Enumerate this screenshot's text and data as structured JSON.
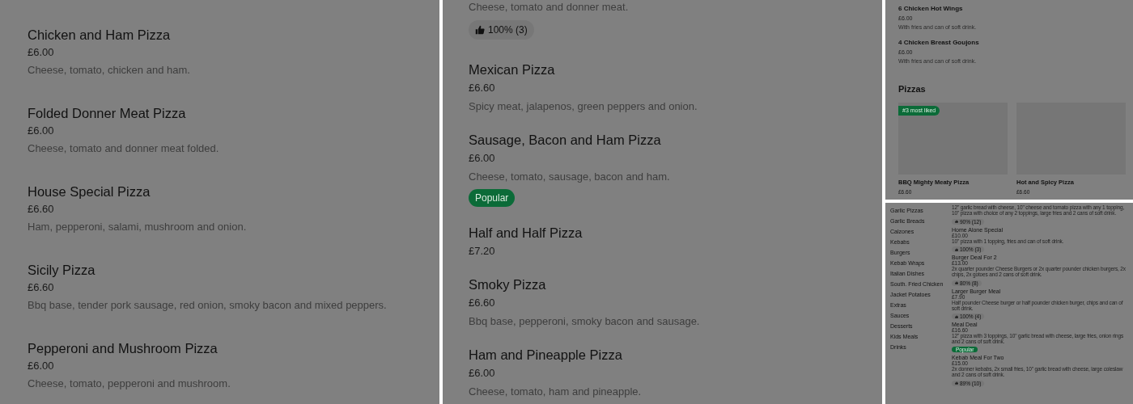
{
  "menu_column_1": {
    "items": [
      {
        "name": "Chicken and Ham Pizza",
        "price": "£6.00",
        "description": "Cheese, tomato, chicken and ham."
      },
      {
        "name": "Folded Donner Meat Pizza",
        "price": "£6.00",
        "description": "Cheese, tomato and donner meat folded."
      },
      {
        "name": "House Special Pizza",
        "price": "£6.60",
        "description": "Ham, pepperoni, salami, mushroom and onion."
      },
      {
        "name": "Sicily Pizza",
        "price": "£6.60",
        "description": "Bbq base, tender pork sausage, red onion, smoky bacon and mixed peppers."
      },
      {
        "name": "Pepperoni and Mushroom Pizza",
        "price": "£6.00",
        "description": "Cheese, tomato, pepperoni and mushroom."
      }
    ]
  },
  "menu_column_2": {
    "items": [
      {
        "description": "Cheese, tomato and donner meat.",
        "rating": "100% (3)"
      },
      {
        "name": "Mexican Pizza",
        "price": "£6.60",
        "description": "Spicy meat, jalapenos, green peppers and onion."
      },
      {
        "name": "Sausage, Bacon and Ham Pizza",
        "price": "£6.00",
        "description": "Cheese, tomato, sausage, bacon and ham.",
        "badge": "Popular"
      },
      {
        "name": "Half and Half Pizza",
        "price": "£7.20"
      },
      {
        "name": "Smoky Pizza",
        "price": "£6.60",
        "description": "Bbq base, pepperoni, smoky bacon and sausage."
      },
      {
        "name": "Ham and Pineapple Pizza",
        "price": "£6.00",
        "description": "Cheese, tomato, ham and pineapple."
      }
    ]
  },
  "compact_view": {
    "items": [
      {
        "name": "6 Chicken Hot Wings",
        "price": "£6.00",
        "description": "With fries and can of soft drink."
      },
      {
        "name": "4 Chicken Breast Goujons",
        "price": "£6.00",
        "description": "With fries and can of soft drink."
      }
    ],
    "section_title": "Pizzas",
    "cards": [
      {
        "name": "BBQ Mighty Meaty Pizza",
        "price": "£6.60",
        "tag": "#3 most liked"
      },
      {
        "name": "Hot and Spicy Pizza",
        "price": "£6.60"
      }
    ]
  },
  "mobile_view": {
    "categories": [
      "Garlic Pizzas",
      "Garlic Breads",
      "Calzones",
      "Kebabs",
      "Burgers",
      "Kebab Wraps",
      "Italian Dishes",
      "South. Fried Chicken",
      "Jacket Potatoes",
      "Extras",
      "Sauces",
      "Desserts",
      "Kids Meals",
      "Drinks"
    ],
    "items": [
      {
        "description": "12\" garlic bread with cheese, 10\" cheese and tomato pizza with any 1 topping, 10\" pizza with choice of any 2 toppings, large fries and 2 cans of soft drink.",
        "rating": "90% (12)"
      },
      {
        "name": "Home Alone Special",
        "price": "£10.00",
        "description": "10\" pizza with 1 topping, fries and can of soft drink.",
        "rating": "100% (3)"
      },
      {
        "name": "Burger Deal For 2",
        "price": "£13.00",
        "description": "2x quarter pounder Cheese Burgers or 2x quarter pounder chicken burgers, 2x chips, 2x gotoes and 2 cans of soft drink.",
        "rating": "80% (8)"
      },
      {
        "name": "Larger Burger Meal",
        "price": "£7.90",
        "description": "Half pounder Cheese burger or half pounder chicken burger, chips and can of soft drink.",
        "rating": "100% (4)"
      },
      {
        "name": "Meal Deal",
        "price": "£16.60",
        "description": "12\" pizza with 3 toppings, 10\" garlic bread with cheese, large fries, onion rings and 2 cans of soft drink.",
        "badge": "Popular"
      },
      {
        "name": "Kebab Meal For Two",
        "price": "£15.00",
        "description": "2x donner kebabs, 2x small fries, 10\" garlic bread with cheese, large coleslaw and 2 cans of soft drink.",
        "rating": "89% (10)"
      }
    ]
  }
}
